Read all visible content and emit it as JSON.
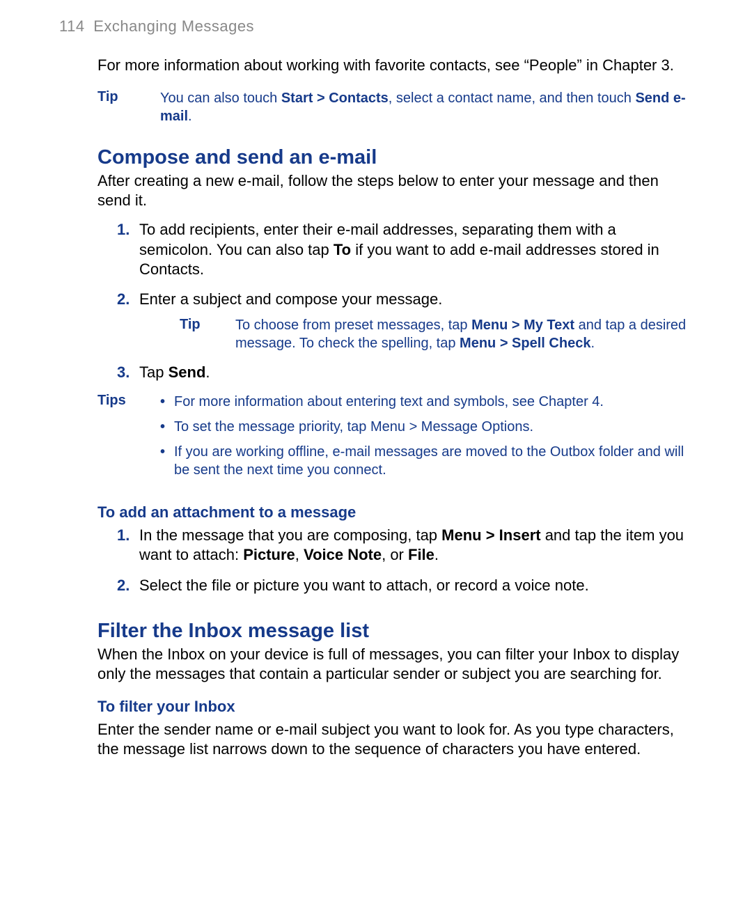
{
  "header": {
    "page_num": "114",
    "section": "Exchanging Messages"
  },
  "intro": {
    "text": "For more information about working with favorite contacts, see “People” in Chapter 3."
  },
  "tip1": {
    "label": "Tip",
    "pre": "You can also touch ",
    "bold1": "Start > Contacts",
    "mid": ", select a contact name, and then touch ",
    "bold2": "Send e-mail",
    "post": "."
  },
  "compose": {
    "heading": "Compose and send an e-mail",
    "intro": "After creating an new e-mail, follow the steps below to enter your message and then send it.",
    "intro_fixed": "After creating a new e-mail, follow the steps below to enter your message and then send it.",
    "steps": {
      "s1": {
        "pre": "To add recipients, enter their e-mail addresses, separating them with a semicolon. You can also tap ",
        "bold": "To",
        "post": " if you want to add e-mail addresses stored in Contacts."
      },
      "s2": {
        "text": "Enter a subject and compose your message."
      },
      "s2tip": {
        "label": "Tip",
        "pre": "To choose from preset messages, tap ",
        "bold1": "Menu > My Text",
        "mid": " and tap a desired message. To check the spelling, tap ",
        "bold2": "Menu > Spell Check",
        "post": "."
      },
      "s3": {
        "pre": "Tap ",
        "bold": "Send",
        "post": "."
      }
    }
  },
  "tips_block": {
    "label": "Tips",
    "items": {
      "t1": {
        "text": "For more information about entering text and symbols, see Chapter 4."
      },
      "t2": {
        "pre": "To set the message priority, tap ",
        "bold": "Menu > Message Options",
        "post": "."
      },
      "t3": {
        "text": "If you are working offline, e-mail messages are moved to the Outbox folder and will be sent the next time you connect."
      }
    }
  },
  "attach": {
    "heading": "To add an attachment to a message",
    "s1": {
      "pre": "In the message that you are composing, tap ",
      "bold1": "Menu > Insert",
      "mid": " and tap the item you want to attach: ",
      "bold2": "Picture",
      "sep1": ", ",
      "bold3": "Voice Note",
      "sep2": ", or ",
      "bold4": "File",
      "post": "."
    },
    "s2": {
      "text": "Select the file or picture you want to attach, or record a voice note."
    }
  },
  "filter": {
    "heading": "Filter the Inbox message list",
    "intro": "When the Inbox on your device is full of messages, you can filter your Inbox to display only the messages that contain a particular sender or subject you are searching for.",
    "sub": "To filter your Inbox",
    "body": "Enter the sender name or e-mail subject you want to look for. As you type characters, the message list narrows down to the sequence of characters you have entered."
  }
}
